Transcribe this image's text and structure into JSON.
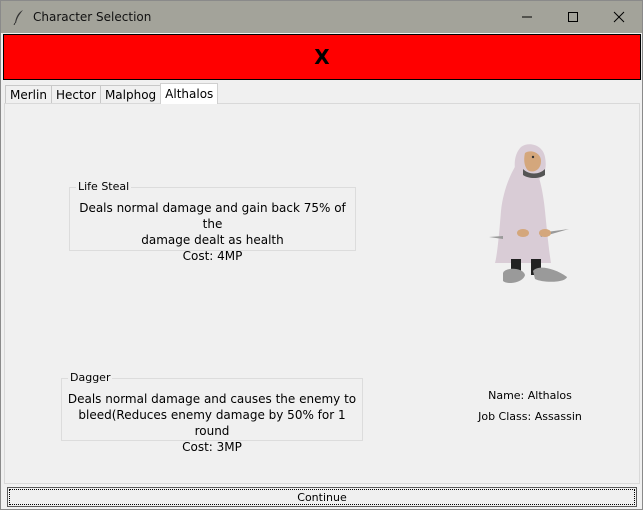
{
  "window": {
    "title": "Character Selection",
    "icon": "feather-icon",
    "controls": [
      "minimize-icon",
      "maximize-icon",
      "close-icon"
    ]
  },
  "banner": {
    "text": "X",
    "color": "#ff0000"
  },
  "tabs": [
    {
      "label": "Merlin",
      "active": false
    },
    {
      "label": "Hector",
      "active": false
    },
    {
      "label": "Malphog",
      "active": false
    },
    {
      "label": "Althalos",
      "active": true
    }
  ],
  "skills": [
    {
      "name": "Life Steal",
      "lines": [
        "Deals normal damage and gain back 75% of the",
        "damage dealt as health"
      ],
      "cost": "Cost: 4MP"
    },
    {
      "name": "Dagger",
      "lines": [
        "Deals normal damage and causes the enemy to",
        "bleed(Reduces enemy damage by 50% for 1 round"
      ],
      "cost": "Cost: 3MP"
    }
  ],
  "character": {
    "name": "Name: Althalos",
    "job": "Job Class: Assassin",
    "sprite": "hooded-assassin-sprite"
  },
  "continue_label": "Continue"
}
